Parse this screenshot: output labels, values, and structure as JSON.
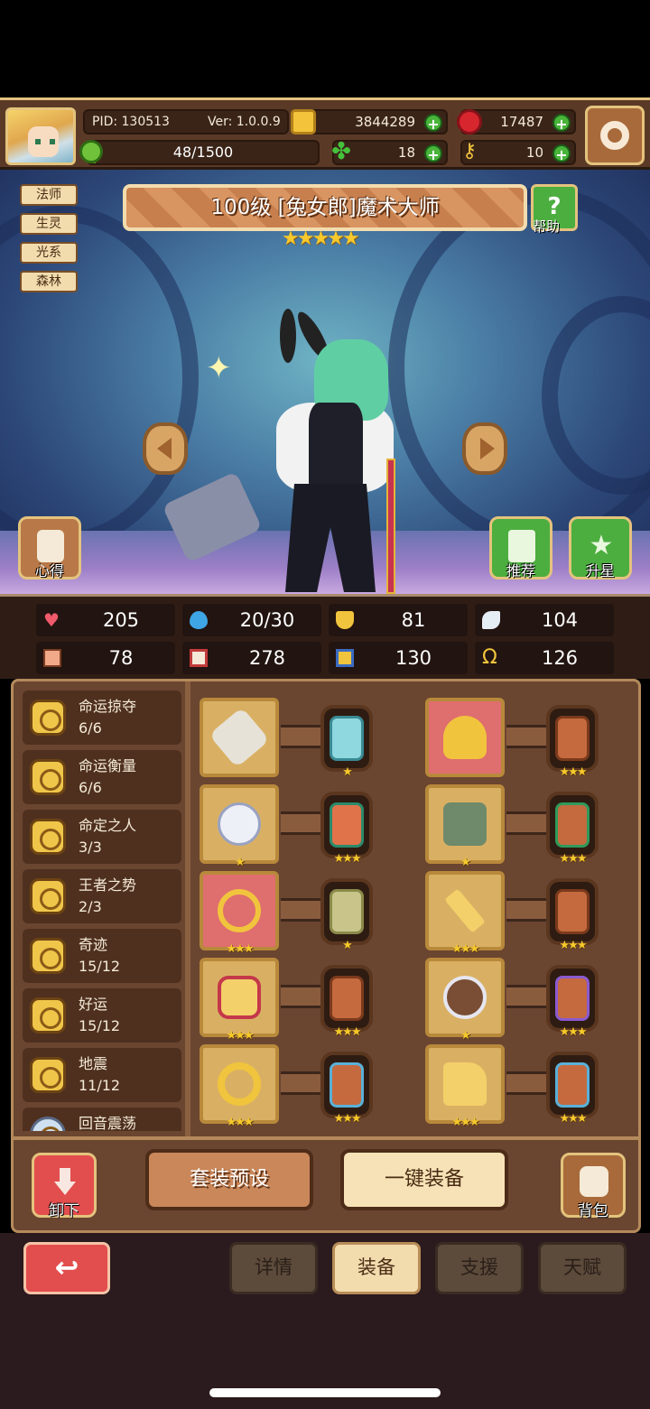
{
  "header": {
    "pid": "PID: 130513",
    "version": "Ver: 1.0.0.9",
    "gold": "3844289",
    "gems": "17487",
    "xp": "48/1500",
    "xp_fraction": 0.032,
    "clovers": "18",
    "keys": "10"
  },
  "hero": {
    "tags": [
      "法师",
      "生灵",
      "光系",
      "森林"
    ],
    "title": "100级 [兔女郎]魔术大师",
    "stars": 5,
    "help_label": "帮助",
    "insight_label": "心得",
    "recommend_label": "推荐",
    "star_up_label": "升星"
  },
  "stats": {
    "hp": "205",
    "mana": "20/30",
    "defense": "81",
    "speed": "104",
    "attack": "78",
    "magic": "278",
    "resist": "130",
    "luck": "126"
  },
  "sets": [
    {
      "name": "命运掠夺",
      "count": "6/6"
    },
    {
      "name": "命运衡量",
      "count": "6/6"
    },
    {
      "name": "命定之人",
      "count": "3/3"
    },
    {
      "name": "王者之势",
      "count": "2/3"
    },
    {
      "name": "奇迹",
      "count": "15/12"
    },
    {
      "name": "好运",
      "count": "15/12"
    },
    {
      "name": "地震",
      "count": "11/12"
    },
    {
      "name": "回音震荡",
      "count": ""
    }
  ],
  "equipment": [
    {
      "item": "axe-icon",
      "item_stars": "",
      "rune_stars": "★"
    },
    {
      "item": "straw-hat-icon",
      "item_stars": "",
      "rune_stars": "★★★"
    },
    {
      "item": "pearl-icon",
      "item_stars": "★",
      "rune_stars": "★★★"
    },
    {
      "item": "armor-icon",
      "item_stars": "★",
      "rune_stars": "★★★"
    },
    {
      "item": "necklace-icon",
      "item_stars": "★★★",
      "rune_stars": "★"
    },
    {
      "item": "wand-icon",
      "item_stars": "★★★",
      "rune_stars": "★★★"
    },
    {
      "item": "gem-brooch-icon",
      "item_stars": "★★★",
      "rune_stars": "★★★"
    },
    {
      "item": "bracer-icon",
      "item_stars": "★",
      "rune_stars": "★★★"
    },
    {
      "item": "ring-icon",
      "item_stars": "★★★",
      "rune_stars": "★★★"
    },
    {
      "item": "boots-icon",
      "item_stars": "★★★",
      "rune_stars": "★★★"
    }
  ],
  "actions": {
    "unequip": "卸下",
    "preset": "套装预设",
    "equip_all": "一键装备",
    "bag": "背包"
  },
  "tabs": {
    "details": "详情",
    "equipment": "装备",
    "support": "支援",
    "talent": "天赋"
  },
  "colors": {
    "accent": "#e4c37d",
    "panel": "#6a4530",
    "green": "#48b43a",
    "red": "#e24d4d"
  }
}
